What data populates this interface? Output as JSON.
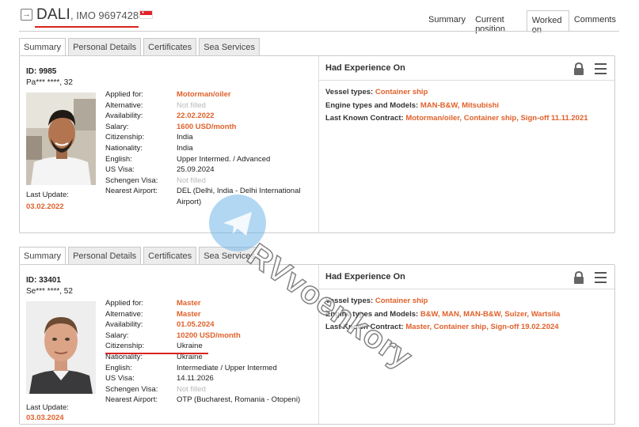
{
  "vessel": {
    "name": "DALI",
    "imo": ", IMO 9697428",
    "flag": "singapore-flag"
  },
  "top_tabs": [
    {
      "label": "Summary",
      "active": false
    },
    {
      "label": "Current position",
      "active": false
    },
    {
      "label": "Worked on",
      "active": true
    },
    {
      "label": "Comments",
      "active": false
    }
  ],
  "card_tabs": [
    "Summary",
    "Personal Details",
    "Certificates",
    "Sea Services"
  ],
  "labels": {
    "applied_for": "Applied for:",
    "alternative": "Alternative:",
    "availability": "Availability:",
    "salary": "Salary:",
    "citizenship": "Citizenship:",
    "nationality": "Nationality:",
    "english": "English:",
    "us_visa": "US Visa:",
    "schengen_visa": "Schengen Visa:",
    "nearest_airport": "Nearest Airport:",
    "last_update": "Last Update:",
    "had_experience": "Had Experience On",
    "vessel_types": "Vessel types: ",
    "engine_types": "Engine types and Models: ",
    "last_contract": "Last Known Contract: "
  },
  "candidates": [
    {
      "id": "ID: 9985",
      "name": "Pa*** ****, 32",
      "applied_for": "Motorman/oiler",
      "alternative": "Not filled",
      "availability": "22.02.2022",
      "salary": "1600 USD/month",
      "citizenship": "India",
      "nationality": "India",
      "english": "Upper Intermed. / Advanced",
      "us_visa": "25.09.2024",
      "schengen_visa": "Not filled",
      "nearest_airport": "DEL (Delhi, India - Delhi International Airport)",
      "last_update": "03.02.2022",
      "vessel_types": "Container ship",
      "engine_types": "MAN-B&W, Mitsubishi",
      "last_contract": "Motorman/oiler, Container ship, Sign-off 11.11.2021"
    },
    {
      "id": "ID: 33401",
      "name": "Se*** ****, 52",
      "applied_for": "Master",
      "alternative": "Master",
      "availability": "01.05.2024",
      "salary": "10200 USD/month",
      "citizenship": "Ukraine",
      "nationality": "Ukraine",
      "english": "Intermediate / Upper Intermed",
      "us_visa": "14.11.2026",
      "schengen_visa": "Not filled",
      "nearest_airport": "OTP (Bucharest, Romania - Otopeni)",
      "last_update": "03.03.2024",
      "vessel_types": "Container ship",
      "engine_types": "B&W, MAN, MAN-B&W, Sulzer, Wartsila",
      "last_contract": "Master, Container ship, Sign-off 19.02.2024"
    }
  ],
  "watermark": "RVvoenkory",
  "colors": {
    "accent_orange": "#e0612b",
    "highlight_red": "#d8231f",
    "muted": "#b9b9b9"
  }
}
